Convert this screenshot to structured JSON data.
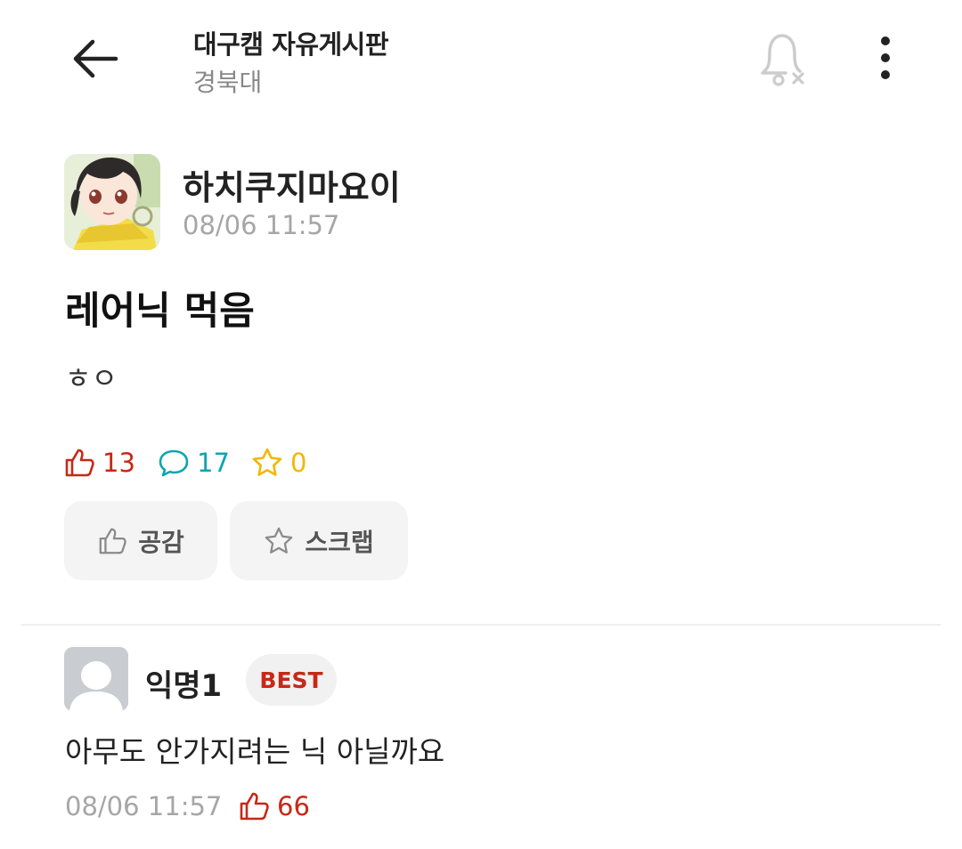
{
  "header": {
    "title": "대구캠 자유게시판",
    "subtitle": "경북대"
  },
  "post": {
    "author": "하치쿠지마요이",
    "time": "08/06 11:57",
    "title": "레어닉 먹음",
    "body": "ㅎㅇ",
    "stats": {
      "likes": "13",
      "comments": "17",
      "scraps": "0"
    },
    "actions": {
      "like_label": "공감",
      "scrap_label": "스크랩"
    }
  },
  "comment": {
    "author": "익명1",
    "badge": "BEST",
    "text": "아무도 안가지려는 닉 아닐까요",
    "time": "08/06 11:57",
    "likes": "66"
  },
  "colors": {
    "like": "#c62917",
    "comment": "#0ca5b0",
    "scrap": "#f2b705",
    "muted": "#a6a6a6",
    "button_bg": "#f4f4f4"
  },
  "icons": [
    "back-arrow-icon",
    "bell-off-icon",
    "more-vertical-icon",
    "thumbs-up-icon",
    "speech-bubble-icon",
    "star-icon",
    "anonymous-avatar-icon"
  ]
}
